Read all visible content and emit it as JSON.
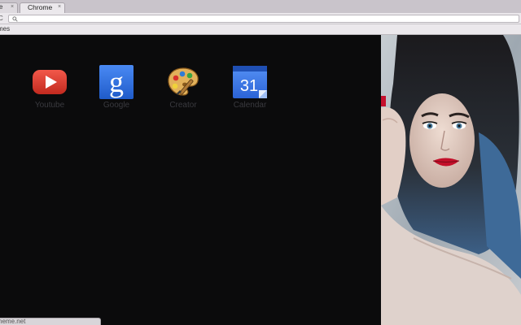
{
  "browser": {
    "tabs": [
      {
        "label": "e",
        "close": "×"
      },
      {
        "label": "Chrome",
        "close": "×"
      }
    ],
    "nav_glyph": "C",
    "bookmarks": {
      "item": "mes"
    },
    "status_url": "heme.net"
  },
  "apps": [
    {
      "label": "Youtube",
      "icon": "youtube-icon"
    },
    {
      "label": "Google",
      "icon": "google-icon"
    },
    {
      "label": "Creator",
      "icon": "palette-icon"
    },
    {
      "label": "Calendar",
      "icon": "calendar-icon"
    }
  ],
  "calendar_day": "31",
  "colors": {
    "background": "#0b0b0c",
    "app_label": "#3a3a3f",
    "youtube_red": "#d9382b",
    "google_blue": "#2f6fe0",
    "calendar_blue": "#3b78e7"
  }
}
